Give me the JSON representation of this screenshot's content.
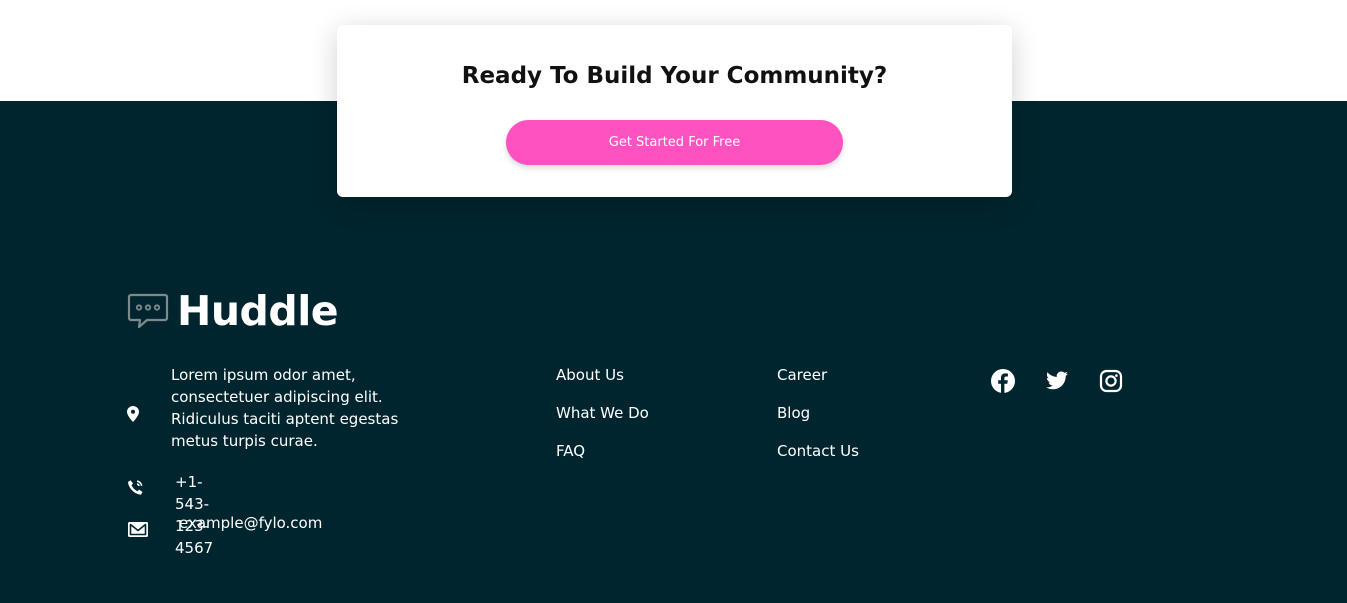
{
  "cta": {
    "title": "Ready To Build Your Community?",
    "button_label": "Get Started For Free"
  },
  "brand": {
    "name": "Huddle",
    "icon": "chat-bubble-icon"
  },
  "contact": {
    "address": "Lorem ipsum odor amet, consectetuer adipiscing elit. Ridiculus taciti aptent egestas metus turpis curae.",
    "address_icon": "location-pin-icon",
    "phone": "+1-543-123-4567",
    "phone_icon": "phone-icon",
    "email": "example@fylo.com",
    "email_icon": "mail-icon"
  },
  "links": {
    "column1": [
      "About Us",
      "What We Do",
      "FAQ"
    ],
    "column2": [
      "Career",
      "Blog",
      "Contact Us"
    ]
  },
  "socials": [
    "facebook-icon",
    "twitter-icon",
    "instagram-icon"
  ],
  "colors": {
    "footer_bg": "#00252e",
    "accent": "#ff52c1",
    "card_bg": "#ffffff",
    "text_light": "#ffffff",
    "text_dark": "#111111"
  }
}
